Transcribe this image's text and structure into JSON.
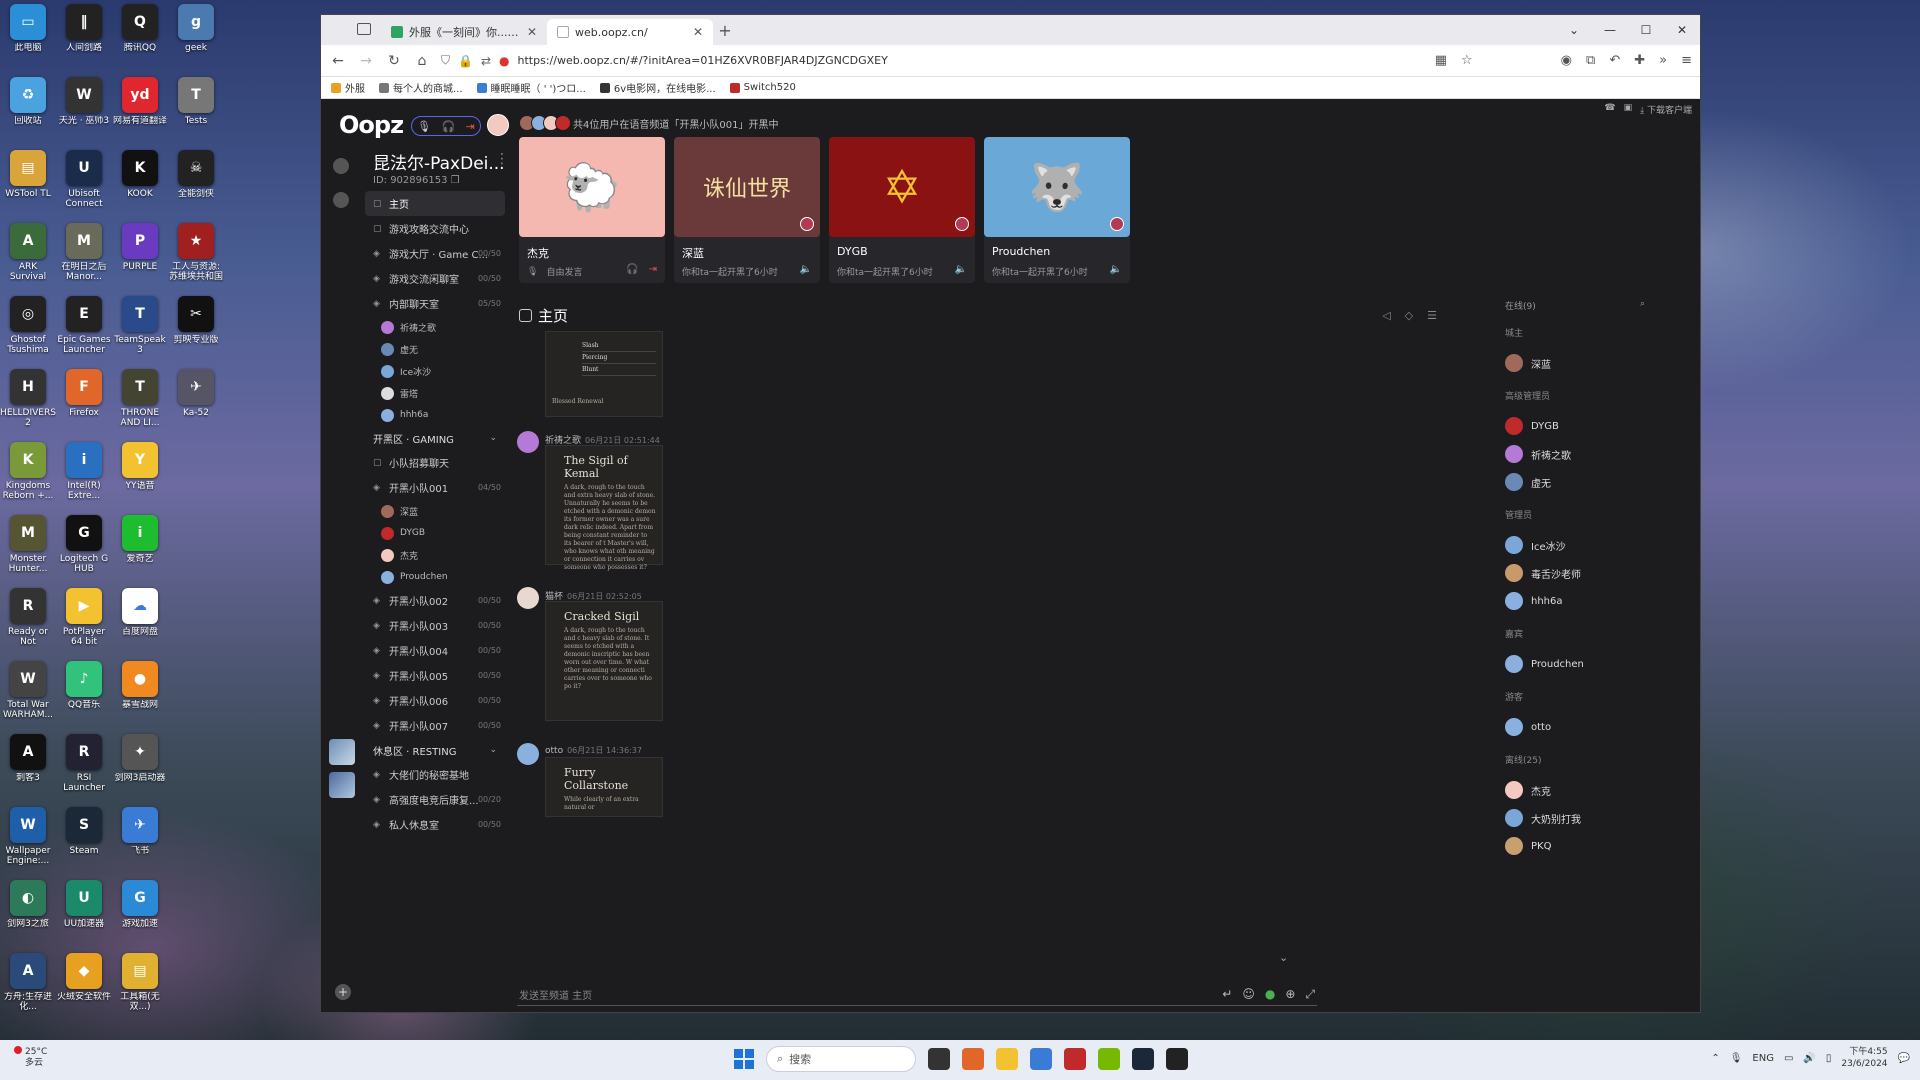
{
  "desktop": {
    "icons": [
      {
        "label": "此电脑",
        "color": "#2a8fd6",
        "glyph": "▭"
      },
      {
        "label": "回收站",
        "color": "#4aa3df",
        "glyph": "♻"
      },
      {
        "label": "WSTool TL",
        "color": "#d9a43a",
        "glyph": "▤"
      },
      {
        "label": "ARK Survival Ascended",
        "color": "#3b6b3a",
        "glyph": "A"
      },
      {
        "label": "Ghostof Tsushima",
        "color": "#222",
        "glyph": "◎"
      },
      {
        "label": "HELLDIVERS 2",
        "color": "#333",
        "glyph": "H"
      },
      {
        "label": "Kingdoms Reborn +...",
        "color": "#7a9a3a",
        "glyph": "K"
      },
      {
        "label": "Monster Hunter...",
        "color": "#553",
        "glyph": "M"
      },
      {
        "label": "Ready or Not",
        "color": "#333",
        "glyph": "R"
      },
      {
        "label": "Total War WARHAM...",
        "color": "#444",
        "glyph": "W"
      },
      {
        "label": "刺客3",
        "color": "#111",
        "glyph": "A"
      },
      {
        "label": "Wallpaper Engine:...",
        "color": "#1f5ea8",
        "glyph": "W"
      },
      {
        "label": "剑网3之旅",
        "color": "#2d7a5a",
        "glyph": "◐"
      },
      {
        "label": "方舟:生存进化...",
        "color": "#2a4a7a",
        "glyph": "A"
      },
      {
        "label": "人间剑路",
        "color": "#222",
        "glyph": "‖"
      },
      {
        "label": "天光 · 巫师3",
        "color": "#333",
        "glyph": "W"
      },
      {
        "label": "Ubisoft Connect",
        "color": "#1b2c4a",
        "glyph": "U"
      },
      {
        "label": "在明日之后 Manor...",
        "color": "#6a6a5a",
        "glyph": "M"
      },
      {
        "label": "Epic Games Launcher",
        "color": "#222",
        "glyph": "E"
      },
      {
        "label": "Firefox",
        "color": "#e0662a",
        "glyph": "F"
      },
      {
        "label": "Intel(R) Extre...",
        "color": "#2a70c0",
        "glyph": "i"
      },
      {
        "label": "Logitech G HUB",
        "color": "#111",
        "glyph": "G"
      },
      {
        "label": "PotPlayer 64 bit",
        "color": "#f2c230",
        "glyph": "▶"
      },
      {
        "label": "QQ音乐",
        "color": "#31c27c",
        "glyph": "♪"
      },
      {
        "label": "RSI Launcher",
        "color": "#223",
        "glyph": "R"
      },
      {
        "label": "Steam",
        "color": "#1b2838",
        "glyph": "S"
      },
      {
        "label": "UU加速器",
        "color": "#1a8a6a",
        "glyph": "U"
      },
      {
        "label": "火绒安全软件",
        "color": "#e8a020",
        "glyph": "◆"
      },
      {
        "label": "腾讯QQ",
        "color": "#222",
        "glyph": "Q"
      },
      {
        "label": "网易有道翻译",
        "color": "#e0262f",
        "glyph": "yd"
      },
      {
        "label": "KOOK",
        "color": "#111",
        "glyph": "K"
      },
      {
        "label": "PURPLE",
        "color": "#6a3ac0",
        "glyph": "P"
      },
      {
        "label": "TeamSpeak 3",
        "color": "#2a4a8a",
        "glyph": "T"
      },
      {
        "label": "THRONE AND LI...",
        "color": "#443",
        "glyph": "T"
      },
      {
        "label": "YY语音",
        "color": "#f2c230",
        "glyph": "Y"
      },
      {
        "label": "爱奇艺",
        "color": "#1ebd2f",
        "glyph": "i"
      },
      {
        "label": "百度网盘",
        "color": "#fff",
        "glyph": "☁"
      },
      {
        "label": "暴雪战网",
        "color": "#f08a20",
        "glyph": "●"
      },
      {
        "label": "剑网3启动器",
        "color": "#555",
        "glyph": "✦"
      },
      {
        "label": "飞书",
        "color": "#3a7bd5",
        "glyph": "✈"
      },
      {
        "label": "游戏加速",
        "color": "#2a8ad6",
        "glyph": "G"
      },
      {
        "label": "工具箱(无双...)",
        "color": "#e0b030",
        "glyph": "▤"
      },
      {
        "label": "geek",
        "color": "#4a7ab0",
        "glyph": "g"
      },
      {
        "label": "Tests",
        "color": "#777",
        "glyph": "T"
      },
      {
        "label": "全能剑侠",
        "color": "#222",
        "glyph": "☠"
      },
      {
        "label": "工人与资源: 苏维埃共和国",
        "color": "#a02020",
        "glyph": "★"
      },
      {
        "label": "剪映专业版",
        "color": "#111",
        "glyph": "✂"
      },
      {
        "label": "Ka-52",
        "color": "#556",
        "glyph": "✈"
      }
    ]
  },
  "browser": {
    "tabs": [
      {
        "title": "外服《一刻间》你... 体验服申请",
        "active": false
      },
      {
        "title": "web.oopz.cn/",
        "active": true
      }
    ],
    "url": "https://web.oopz.cn/#/?initArea=01HZ6XVR0BFJAR4DJZGNCDGXEY",
    "bookmarks": [
      "外服",
      "每个人的商城...",
      "睡眠睡眠（ ' ')つロ...",
      "6v电影网，在线电影...",
      "Switch520"
    ]
  },
  "app": {
    "logo": "Oopz",
    "topstrip": [
      "下载客户端"
    ],
    "server": {
      "name": "昆法尔-PaxDei...",
      "id": "ID: 902896153"
    },
    "channels": [
      {
        "type": "text",
        "name": "主页",
        "count": "",
        "active": true
      },
      {
        "type": "text",
        "name": "游戏攻略交流中心",
        "count": ""
      },
      {
        "type": "voice",
        "name": "游戏大厅 · Game C...",
        "count": "00/50"
      },
      {
        "type": "voice",
        "name": "游戏交流闲聊室",
        "count": "00/50"
      },
      {
        "type": "voice",
        "name": "内部聊天室",
        "count": "05/50"
      },
      {
        "type": "member",
        "name": "祈祷之歌",
        "color": "#b47ad6"
      },
      {
        "type": "member",
        "name": "虚无",
        "color": "#6a8ab5"
      },
      {
        "type": "member",
        "name": "Ice冰沙",
        "color": "#7aa6d8"
      },
      {
        "type": "member",
        "name": "雷塔",
        "color": "#ddd"
      },
      {
        "type": "member",
        "name": "hhh6a",
        "color": "#8ab0e0"
      },
      {
        "type": "category",
        "name": "开黑区 · GAMING"
      },
      {
        "type": "text",
        "name": "小队招募聊天",
        "count": ""
      },
      {
        "type": "voice",
        "name": "开黑小队001",
        "count": "04/50"
      },
      {
        "type": "member",
        "name": "深蓝",
        "color": "#a06a5a"
      },
      {
        "type": "member",
        "name": "DYGB",
        "color": "#c02a2a"
      },
      {
        "type": "member",
        "name": "杰克",
        "color": "#f3c9c0"
      },
      {
        "type": "member",
        "name": "Proudchen",
        "color": "#8ab0e0"
      },
      {
        "type": "voice",
        "name": "开黑小队002",
        "count": "00/50"
      },
      {
        "type": "voice",
        "name": "开黑小队003",
        "count": "00/50"
      },
      {
        "type": "voice",
        "name": "开黑小队004",
        "count": "00/50"
      },
      {
        "type": "voice",
        "name": "开黑小队005",
        "count": "00/50"
      },
      {
        "type": "voice",
        "name": "开黑小队006",
        "count": "00/50"
      },
      {
        "type": "voice",
        "name": "开黑小队007",
        "count": "00/50"
      },
      {
        "type": "category",
        "name": "休息区 · RESTING"
      },
      {
        "type": "voice",
        "name": "大佬们的秘密基地",
        "count": ""
      },
      {
        "type": "voice",
        "name": "高强度电竞后康复...",
        "count": "00/20"
      },
      {
        "type": "voice",
        "name": "私人休息室",
        "count": "00/50"
      }
    ],
    "voice_banner": "共4位用户在语音频道「开黑小队001」开黑中",
    "voice_cards": [
      {
        "name": "杰克",
        "status": "自由发言",
        "bg": "#f4b8b0",
        "art": "🐑"
      },
      {
        "name": "深蓝",
        "status": "你和ta一起开黑了6小时",
        "bg": "#6a3a3a",
        "art": "诛仙世界"
      },
      {
        "name": "DYGB",
        "status": "你和ta一起开黑了6小时",
        "bg": "#8a1212",
        "art": "✡"
      },
      {
        "name": "Proudchen",
        "status": "你和ta一起开黑了6小时",
        "bg": "#6aa8d8",
        "art": "🐺"
      }
    ],
    "page_title": "主页",
    "messages": [
      {
        "user": "",
        "time": "",
        "avatar": "",
        "shot_title": "",
        "shot_body": "",
        "items": [
          "Slash",
          "Piercing",
          "Blunt"
        ],
        "footer": "Blessed Renewal"
      },
      {
        "user": "祈祷之歌",
        "time": "06月21日 02:51:44",
        "avatar": "#b47ad6",
        "shot_title": "The Sigil of Kemal",
        "shot_body": "A dark, rough to the touch and extra heavy slab of stone. Unnaturally he seems to be etched with a demonic demon its former owner was a sure dark relic indeed. Apart from being constant reminder to its bearer of t Master's will, who knows what oth meaning or connection it carries ov someone who possesses it?"
      },
      {
        "user": "猫杯",
        "time": "06月21日 02:52:05",
        "avatar": "#e8d8d0",
        "shot_title": "Cracked Sigil",
        "shot_body": "A dark, rough to the touch and c heavy slab of stone. It seems to etched with a demonic inscriptic has been worn out over time. W what other meaning or connecti carries over to someone who po it?"
      },
      {
        "user": "otto",
        "time": "06月21日 14:36:37",
        "avatar": "#8ab0e0",
        "shot_title": "Furry Collarstone",
        "shot_body": "While clearly of an extra natural or"
      }
    ],
    "composer": {
      "placeholder": "发送至频道 主页"
    },
    "members": {
      "online_header": "在线(9)",
      "groups": [
        {
          "name": "城主",
          "members": [
            {
              "name": "深蓝",
              "color": "#a06a5a"
            }
          ]
        },
        {
          "name": "高级管理员",
          "members": [
            {
              "name": "DYGB",
              "color": "#c02a2a"
            },
            {
              "name": "祈祷之歌",
              "color": "#b47ad6"
            },
            {
              "name": "虚无",
              "color": "#6a8ab5"
            }
          ]
        },
        {
          "name": "管理员",
          "members": [
            {
              "name": "Ice冰沙",
              "color": "#7aa6d8"
            },
            {
              "name": "毒舌沙老师",
              "color": "#c89a6a"
            },
            {
              "name": "hhh6a",
              "color": "#8ab0e0"
            }
          ]
        },
        {
          "name": "嘉宾",
          "members": [
            {
              "name": "Proudchen",
              "color": "#8ab0e0"
            }
          ]
        },
        {
          "name": "游客",
          "members": [
            {
              "name": "otto",
              "color": "#8ab0e0"
            }
          ]
        },
        {
          "name": "离线(25)",
          "members": [
            {
              "name": "杰克",
              "color": "#f3c9c0"
            },
            {
              "name": "大奶别打我",
              "color": "#7aa6d8"
            },
            {
              "name": "PKQ",
              "color": "#c8a070"
            }
          ]
        }
      ]
    }
  },
  "taskbar": {
    "weather_temp": "25°C",
    "weather_desc": "多云",
    "search_placeholder": "搜索",
    "apps": [
      {
        "name": "task-view",
        "color": "#333"
      },
      {
        "name": "firefox",
        "color": "#e0662a"
      },
      {
        "name": "explorer",
        "color": "#f2c230"
      },
      {
        "name": "feishu",
        "color": "#3a7bd5"
      },
      {
        "name": "voicemeeter",
        "color": "#c02a2a"
      },
      {
        "name": "gfe",
        "color": "#76b900"
      },
      {
        "name": "steam",
        "color": "#1b2838"
      },
      {
        "name": "epic-helper",
        "color": "#222"
      }
    ],
    "lang": "ENG",
    "time": "下午4:55",
    "date": "23/6/2024"
  }
}
